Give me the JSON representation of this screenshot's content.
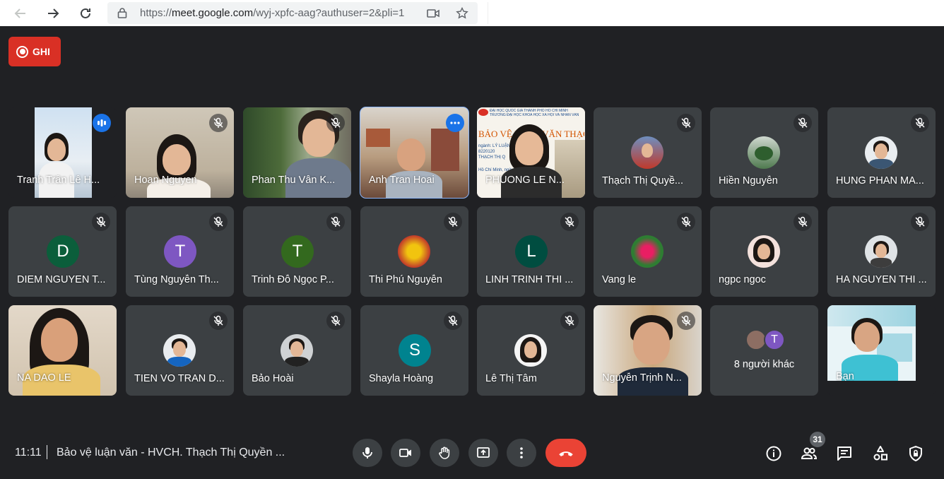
{
  "browser": {
    "url_prefix": "https://",
    "url_host": "meet.google.com",
    "url_path": "/wyj-xpfc-aag?authuser=2&pli=1"
  },
  "record": {
    "label": "GHI"
  },
  "participants": [
    {
      "name": "Tranh Trần Lê H...",
      "type": "video"
    },
    {
      "name": "Hoan Nguyen",
      "type": "video"
    },
    {
      "name": "Phan Thu Vân K...",
      "type": "video"
    },
    {
      "name": "Anh Tran Hoai",
      "type": "video"
    },
    {
      "name": "PHUONG LE N...",
      "type": "video"
    },
    {
      "name": "Thạch Thị Quyề...",
      "type": "photo"
    },
    {
      "name": "Hiền Nguyễn",
      "type": "photo"
    },
    {
      "name": "HUNG PHAN MA...",
      "type": "photo"
    },
    {
      "name": "DIEM NGUYEN T...",
      "type": "letter",
      "letter": "D",
      "color": "#0b5e3b"
    },
    {
      "name": "Tùng Nguyễn Th...",
      "type": "letter",
      "letter": "T",
      "color": "#7e57c2"
    },
    {
      "name": "Trinh Đỗ Ngọc P...",
      "type": "letter",
      "letter": "T",
      "color": "#33691e"
    },
    {
      "name": "Thi Phú Nguyễn",
      "type": "photo"
    },
    {
      "name": "LINH TRINH THI ...",
      "type": "letter",
      "letter": "L",
      "color": "#004d40"
    },
    {
      "name": "Vang le",
      "type": "photo"
    },
    {
      "name": "ngpc ngoc",
      "type": "photo"
    },
    {
      "name": "HA NGUYEN THI ...",
      "type": "photo"
    },
    {
      "name": "NA DAO LE",
      "type": "video"
    },
    {
      "name": "TIEN VO TRAN D...",
      "type": "photo"
    },
    {
      "name": "Bảo Hoài",
      "type": "photo"
    },
    {
      "name": "Shayla Hoàng",
      "type": "letter",
      "letter": "S",
      "color": "#00838f"
    },
    {
      "name": "Lê Thị Tâm",
      "type": "photo"
    },
    {
      "name": "Nguyễn Trịnh N...",
      "type": "video"
    },
    {
      "name": "8 người khác",
      "type": "others",
      "letter": "T"
    },
    {
      "name": "Bạn",
      "type": "video"
    }
  ],
  "slide_text": {
    "banner_line1": "ĐẠI HỌC QUỐC GIA THÀNH PHỐ HỒ CHÍ MINH",
    "banner_line2": "TRƯỜNG ĐẠI HỌC KHOA HỌC XÃ HỘI VÀ NHÂN VĂN",
    "big": "BẢO VỆ LUẬN VĂN THẠC",
    "line3": "ngành: LÝ LUẬN",
    "line4": "8220120",
    "line5": "THẠCH THỊ Q",
    "line6": "Hồ Chí Minh, ngày"
  },
  "bottom": {
    "time": "11:11",
    "title": "Bảo vệ luận văn - HVCH. Thạch Thị Quyền ...",
    "participant_count": "31"
  },
  "colors": {
    "background": "#202124",
    "tile": "#3c4043",
    "leave": "#ea4335",
    "record": "#d93025",
    "accent": "#1a73e8"
  }
}
